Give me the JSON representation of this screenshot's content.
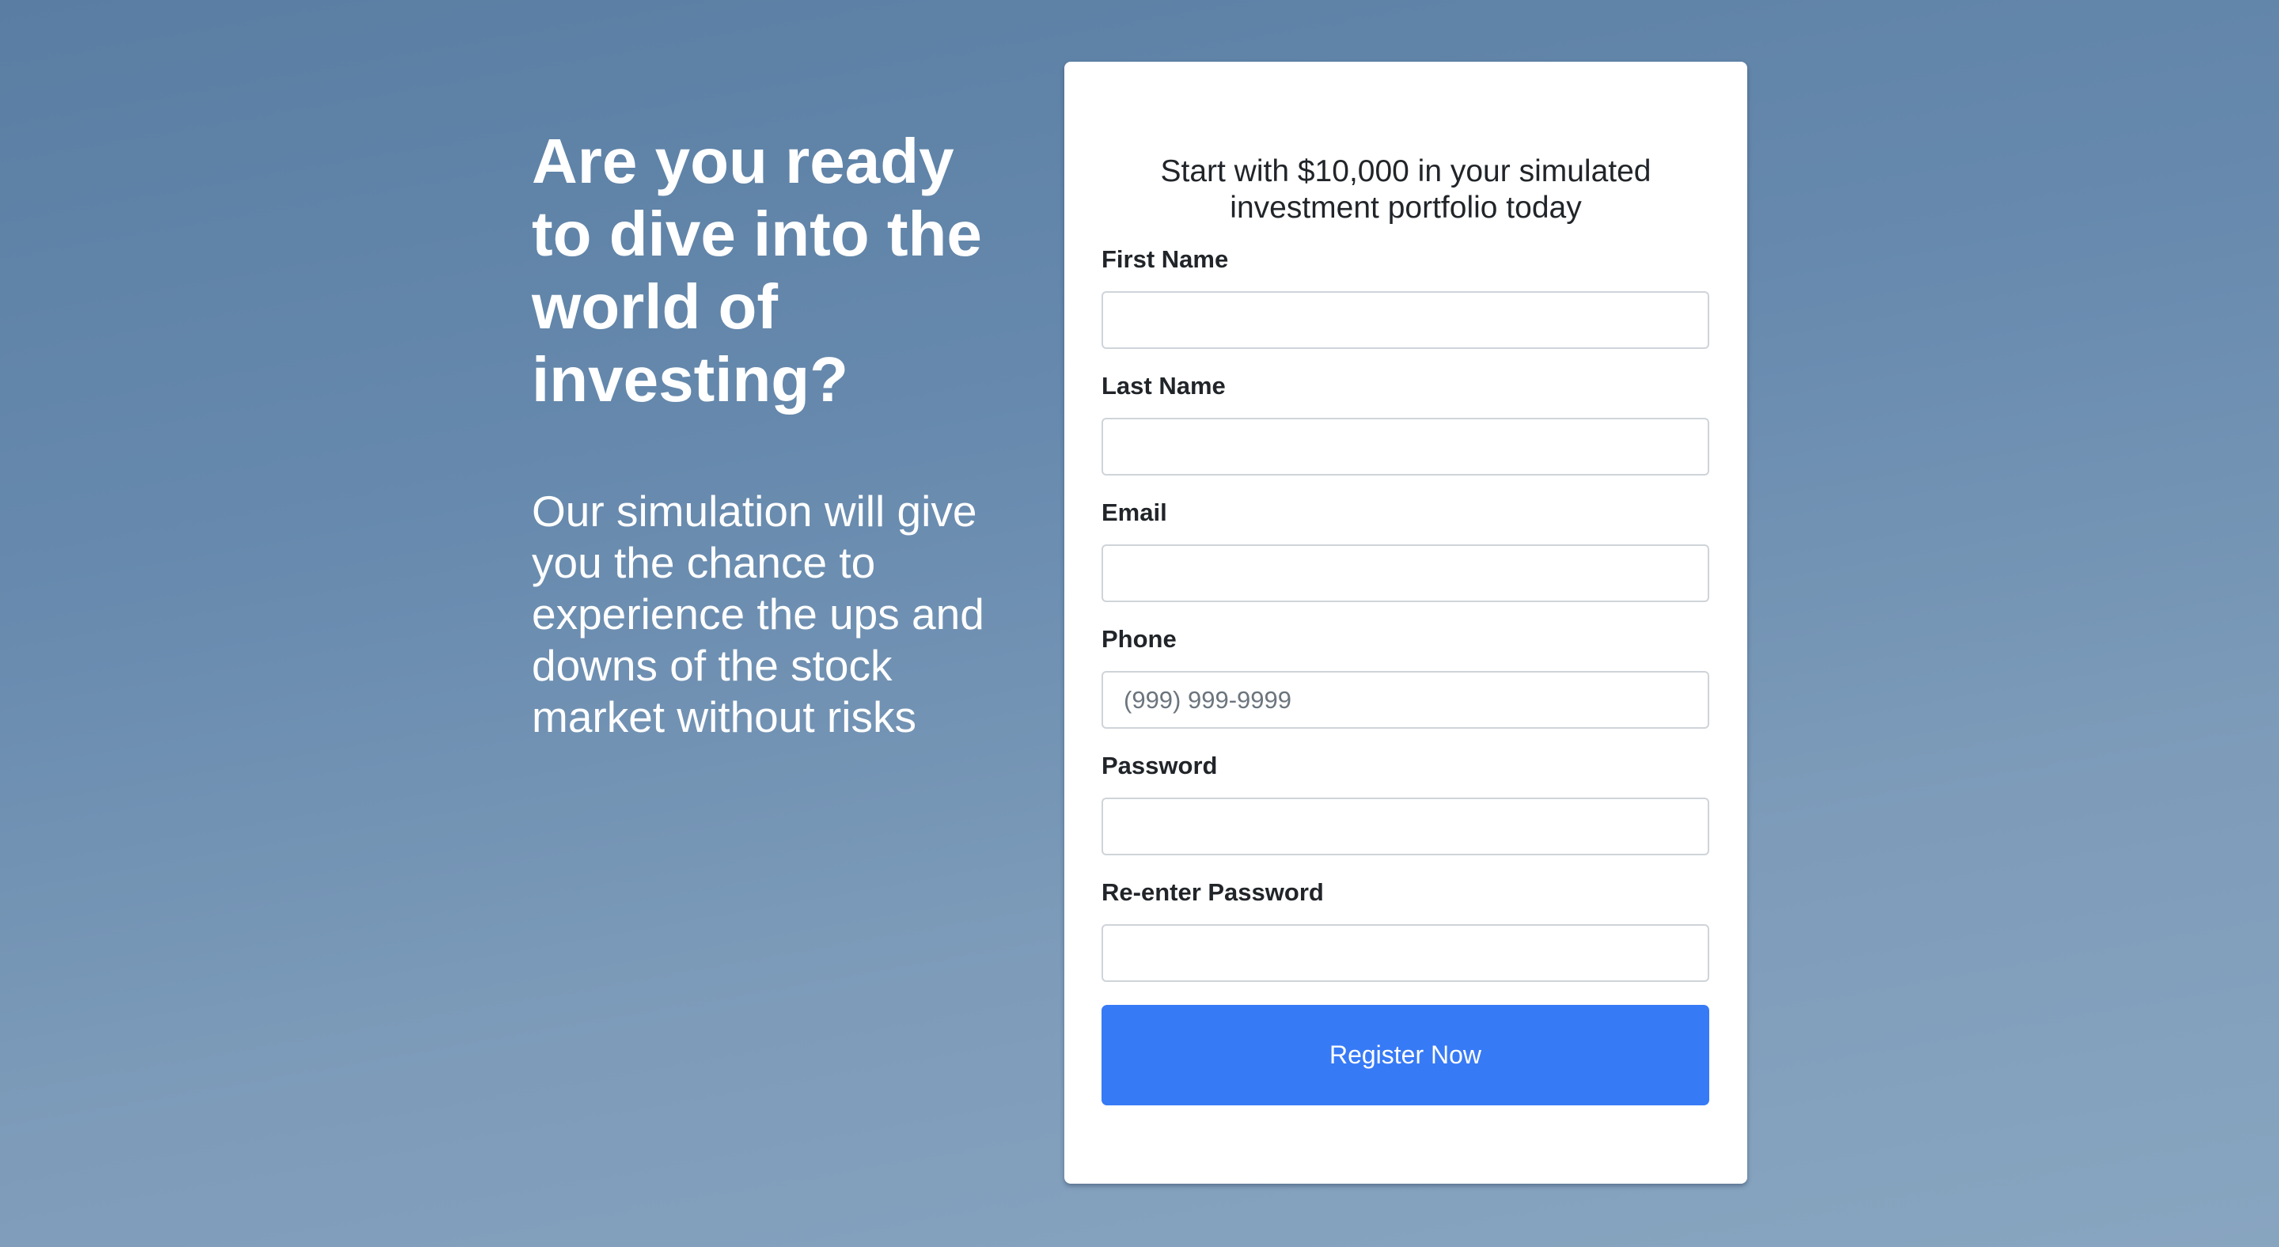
{
  "hero": {
    "heading": "Are you ready to dive into the world of investing?",
    "description": "Our simulation will give you the chance to experience the ups and downs of the stock market without risks"
  },
  "form": {
    "subtitle": "Start with $10,000 in your simulated investment portfolio today",
    "fields": [
      {
        "label": "First Name",
        "value": "",
        "placeholder": ""
      },
      {
        "label": "Last Name",
        "value": "",
        "placeholder": ""
      },
      {
        "label": "Email",
        "value": "",
        "placeholder": ""
      },
      {
        "label": "Phone",
        "value": "",
        "placeholder": "(999) 999-9999"
      },
      {
        "label": "Password",
        "value": "",
        "placeholder": ""
      },
      {
        "label": "Re-enter Password",
        "value": "",
        "placeholder": ""
      }
    ],
    "submit_label": "Register Now"
  },
  "colors": {
    "accent": "#377af6",
    "background": "#6f8fb2"
  }
}
